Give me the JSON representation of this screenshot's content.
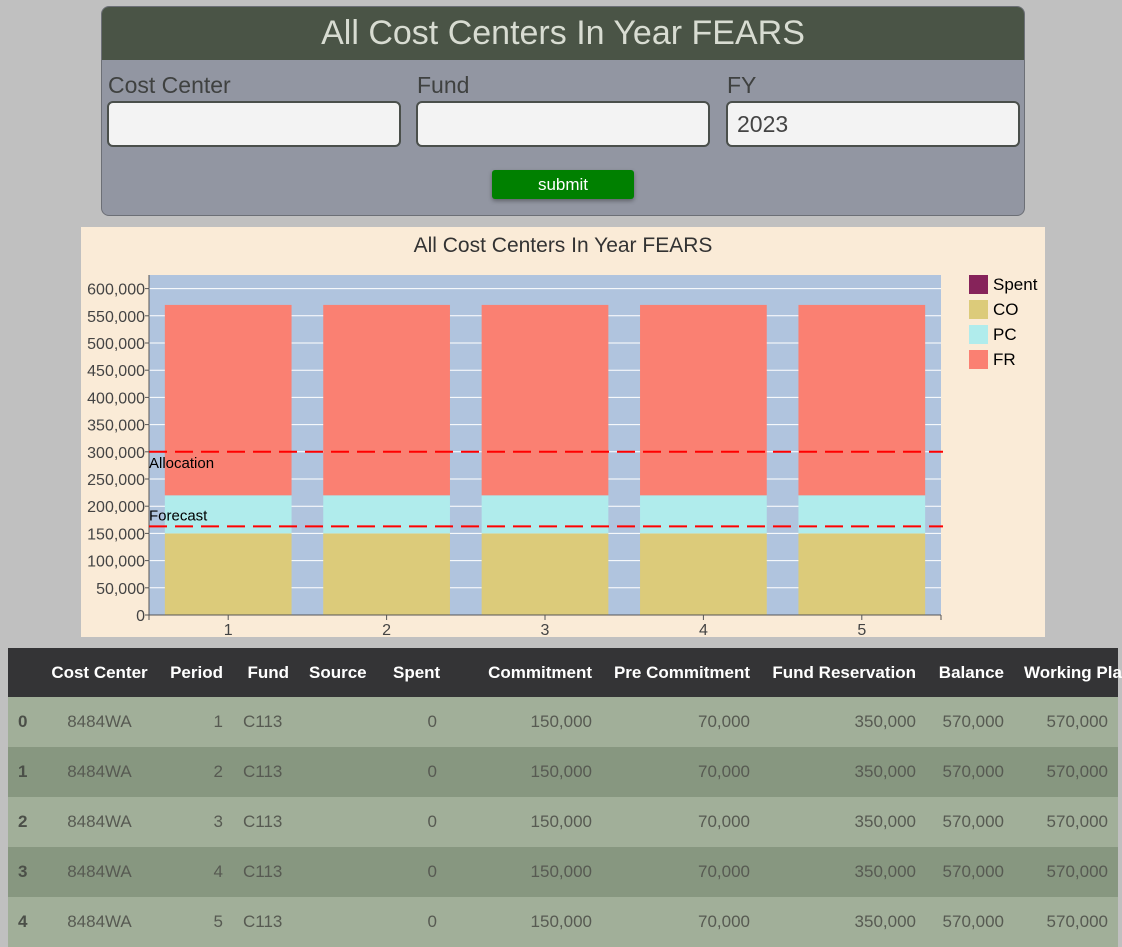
{
  "form": {
    "title": "All Cost Centers In Year FEARS",
    "cost_center_label": "Cost Center",
    "cost_center_value": "",
    "fund_label": "Fund",
    "fund_value": "",
    "fy_label": "FY",
    "fy_value": "2023",
    "submit_label": "submit"
  },
  "chart_data": {
    "type": "bar",
    "stacked": true,
    "title": "All Cost Centers In Year FEARS",
    "categories": [
      "1",
      "2",
      "3",
      "4",
      "5"
    ],
    "series": [
      {
        "name": "Spent",
        "color": "#86235a",
        "values": [
          0,
          0,
          0,
          0,
          0
        ]
      },
      {
        "name": "CO",
        "color": "#dccb7a",
        "values": [
          150000,
          150000,
          150000,
          150000,
          150000
        ]
      },
      {
        "name": "PC",
        "color": "#b0ecec",
        "values": [
          70000,
          70000,
          70000,
          70000,
          70000
        ]
      },
      {
        "name": "FR",
        "color": "#fa8072",
        "values": [
          350000,
          350000,
          350000,
          350000,
          350000
        ]
      }
    ],
    "ylim": [
      0,
      625000
    ],
    "yticks": [
      "0",
      "50,000",
      "100,000",
      "150,000",
      "200,000",
      "250,000",
      "300,000",
      "350,000",
      "400,000",
      "450,000",
      "500,000",
      "550,000",
      "600,000"
    ],
    "ytick_values": [
      0,
      50000,
      100000,
      150000,
      200000,
      250000,
      300000,
      350000,
      400000,
      450000,
      500000,
      550000,
      600000
    ],
    "reference_lines": [
      {
        "label": "Allocation",
        "value": 300000,
        "color": "#ff0000"
      },
      {
        "label": "Forecast",
        "value": 163000,
        "color": "#ff0000"
      }
    ],
    "grid": true,
    "plot_background": "#b0c4de",
    "legend_position": "right"
  },
  "table": {
    "columns": [
      "",
      "Cost Center",
      "Period",
      "Fund",
      "Source",
      "Spent",
      "Commitment",
      "Pre Commitment",
      "Fund Reservation",
      "Balance",
      "Working Plan"
    ],
    "rows": [
      [
        "0",
        "8484WA",
        "1",
        "C113",
        "",
        "0",
        "150,000",
        "70,000",
        "350,000",
        "570,000",
        "570,000"
      ],
      [
        "1",
        "8484WA",
        "2",
        "C113",
        "",
        "0",
        "150,000",
        "70,000",
        "350,000",
        "570,000",
        "570,000"
      ],
      [
        "2",
        "8484WA",
        "3",
        "C113",
        "",
        "0",
        "150,000",
        "70,000",
        "350,000",
        "570,000",
        "570,000"
      ],
      [
        "3",
        "8484WA",
        "4",
        "C113",
        "",
        "0",
        "150,000",
        "70,000",
        "350,000",
        "570,000",
        "570,000"
      ],
      [
        "4",
        "8484WA",
        "5",
        "C113",
        "",
        "0",
        "150,000",
        "70,000",
        "350,000",
        "570,000",
        "570,000"
      ]
    ]
  }
}
